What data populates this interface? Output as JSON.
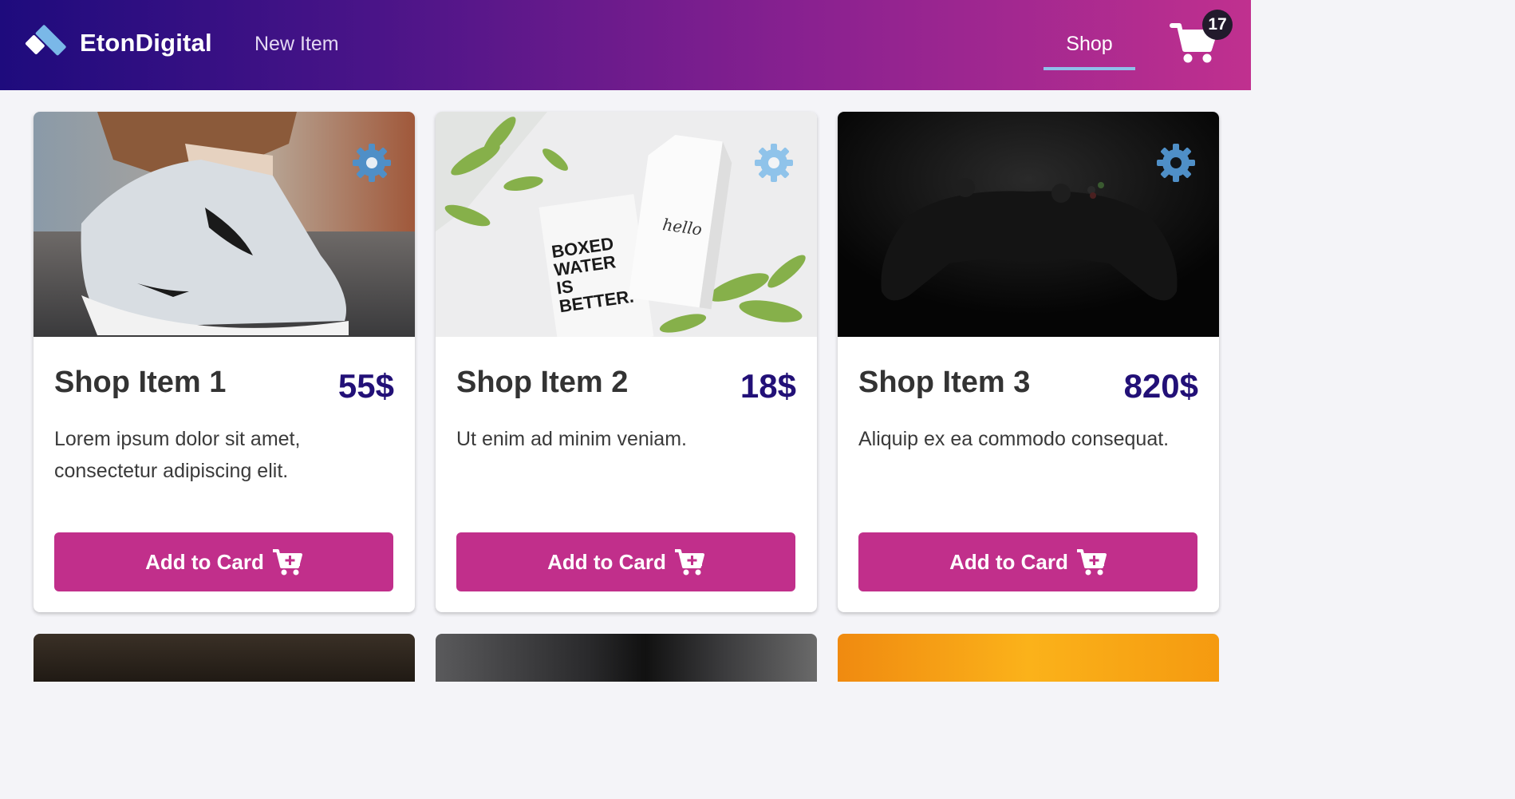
{
  "header": {
    "brand": "EtonDigital",
    "nav": {
      "new_item": "New Item",
      "shop": "Shop"
    },
    "cart_count": "17",
    "logo_icon": "etondigital-logo-icon",
    "cart_icon": "shopping-cart-icon"
  },
  "colors": {
    "header_gradient_start": "#1e0b7d",
    "header_gradient_end": "#c0308f",
    "accent_button": "#c12f8b",
    "price": "#221077",
    "active_underline": "#8fc0ea",
    "gear": "#4f8fc7"
  },
  "items": [
    {
      "title": "Shop Item 1",
      "price": "55$",
      "description": "Lorem ipsum dolor sit amet, consectetur adipiscing elit.",
      "button_label": "Add to Card",
      "image": "sneaker-photo",
      "settings_icon": "gear-icon"
    },
    {
      "title": "Shop Item 2",
      "price": "18$",
      "description": "Ut enim ad minim veniam.",
      "button_label": "Add to Card",
      "image": "boxed-water-photo",
      "image_text": [
        "BOXED",
        "WATER",
        "IS",
        "BETTER.",
        "hello"
      ],
      "settings_icon": "gear-icon"
    },
    {
      "title": "Shop Item 3",
      "price": "820$",
      "description": "Aliquip ex ea commodo consequat.",
      "button_label": "Add to Card",
      "image": "game-controller-photo",
      "settings_icon": "gear-icon"
    }
  ]
}
